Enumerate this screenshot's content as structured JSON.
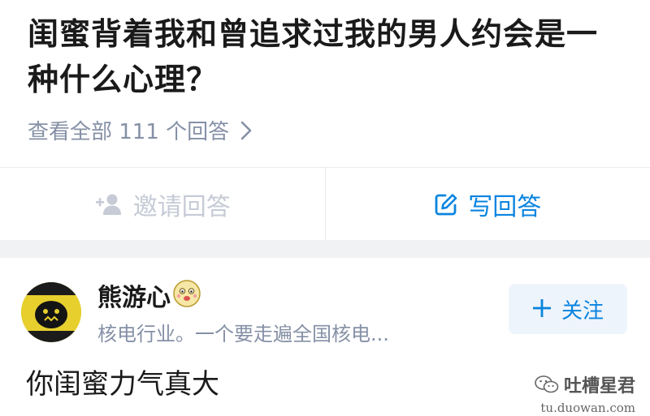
{
  "question": {
    "title": "闺蜜背着我和曾追求过我的男人约会是一种什么心理？",
    "view_all": "查看全部 111 个回答"
  },
  "actions": {
    "invite_label": "邀请回答",
    "write_label": "写回答"
  },
  "answer": {
    "author_name": "熊游心",
    "author_bio": "核电行业。一个要走遍全国核电...",
    "follow_label": "关注",
    "text": "你闺蜜力气真大"
  },
  "watermark": {
    "brand": "吐槽星君",
    "site": "tu.duowan.com"
  },
  "colors": {
    "accent": "#0a84e0",
    "muted": "#8590a6",
    "disabled": "#c6cbd6",
    "divider": "#f1f2f4",
    "follow_bg": "#eef4fb"
  },
  "icons": {
    "view_all": "chevron-right-icon",
    "invite": "add-user-icon",
    "write": "edit-icon",
    "follow": "plus-icon",
    "badge": "emoji-badge-icon",
    "watermark": "wechat-icon"
  }
}
